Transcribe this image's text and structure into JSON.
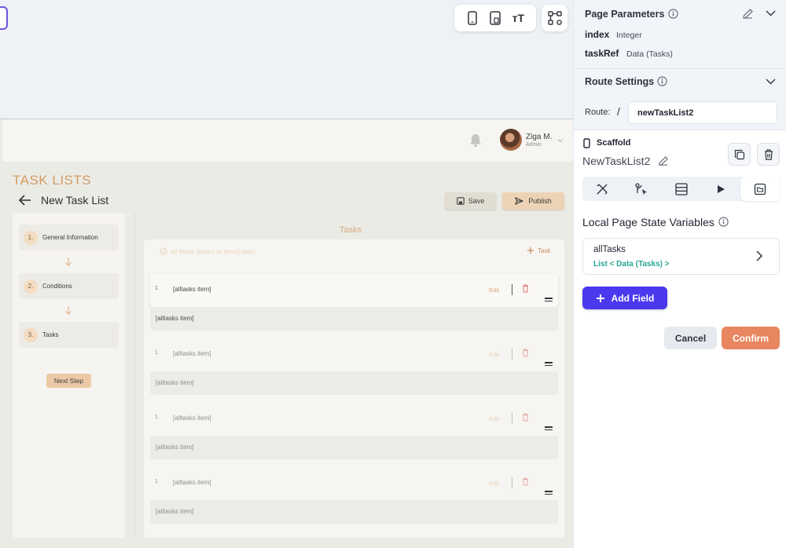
{
  "canvas": {
    "toolbar": {
      "items": [
        {
          "icon": "phone-icon"
        },
        {
          "icon": "tablet-icon"
        },
        {
          "icon": "text-size-icon",
          "label": "тT"
        }
      ],
      "tree_icon": "widget-tree-icon"
    }
  },
  "app": {
    "header": {
      "user_name": "Ziga M.",
      "user_role": "Admin"
    },
    "page_heading": "TASK LISTS",
    "page_subtitle": "New Task List",
    "save_label": "Save",
    "publish_label": "Publish",
    "steps": [
      {
        "num": "1.",
        "label": "General Information"
      },
      {
        "num": "2.",
        "label": "Conditions"
      },
      {
        "num": "3.",
        "label": "Tasks"
      }
    ],
    "next_step_label": "Next Step",
    "tasks_title": "Tasks",
    "tasks_header_label": "All Tasks: [Num List Items] tasks",
    "add_task_label": "Task",
    "tasks": [
      {
        "index": "1",
        "title": "[alltasks item]",
        "edit": "Edit",
        "detail": "[alltasks item]"
      },
      {
        "index": "1",
        "title": "[alltasks item]",
        "edit": "Edit",
        "detail": "[alltasks item]"
      },
      {
        "index": "1",
        "title": "[alltasks item]",
        "edit": "Edit",
        "detail": "[alltasks item]"
      },
      {
        "index": "1",
        "title": "[alltasks item]",
        "edit": "Edit",
        "detail": "[alltasks item]"
      }
    ]
  },
  "panel": {
    "page_parameters": {
      "title": "Page Parameters",
      "params": [
        {
          "name": "index",
          "type": "Integer"
        },
        {
          "name": "taskRef",
          "type": "Data (Tasks)"
        }
      ]
    },
    "route_settings": {
      "title": "Route Settings",
      "route_label": "Route:",
      "route_prefix": "/",
      "route_value": "newTaskList2"
    },
    "scaffold_label": "Scaffold",
    "page_name": "NewTaskList2",
    "local_state": {
      "title": "Local Page State Variables",
      "variables": [
        {
          "name": "allTasks",
          "type": "List < Data (Tasks) >"
        }
      ]
    },
    "add_field_label": "Add Field",
    "cancel_label": "Cancel",
    "confirm_label": "Confirm"
  }
}
